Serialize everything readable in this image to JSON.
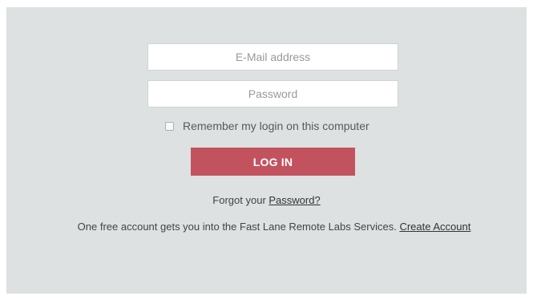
{
  "login_form": {
    "email_placeholder": "E-Mail address",
    "password_placeholder": "Password",
    "remember_label": "Remember my login on this computer",
    "remember_checked": false,
    "login_button_label": "LOG IN"
  },
  "footer": {
    "forgot_prefix": "Forgot your ",
    "forgot_link": "Password?",
    "info_text": "One free account gets you into the Fast Lane Remote Labs Services. ",
    "create_account_link": "Create Account"
  },
  "colors": {
    "panel_background": "#dde1e1",
    "login_button": "#c3525f"
  }
}
